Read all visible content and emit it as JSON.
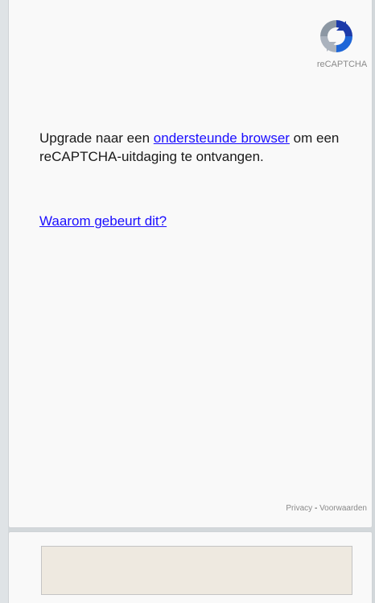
{
  "recaptcha": {
    "brand": "reCAPTCHA",
    "message_prefix": "Upgrade naar een ",
    "supported_browser_link": "ondersteunde browser",
    "message_suffix": " om een reCAPTCHA-uitdaging te ontvangen.",
    "why_link": "Waarom gebeurt dit?"
  },
  "footer": {
    "privacy": "Privacy",
    "separator": " - ",
    "terms": "Voorwaarden"
  },
  "response_field": {
    "value": ""
  },
  "colors": {
    "link": "#1a0dff",
    "panel": "#f9f9f9",
    "textarea": "#eee9e0"
  }
}
